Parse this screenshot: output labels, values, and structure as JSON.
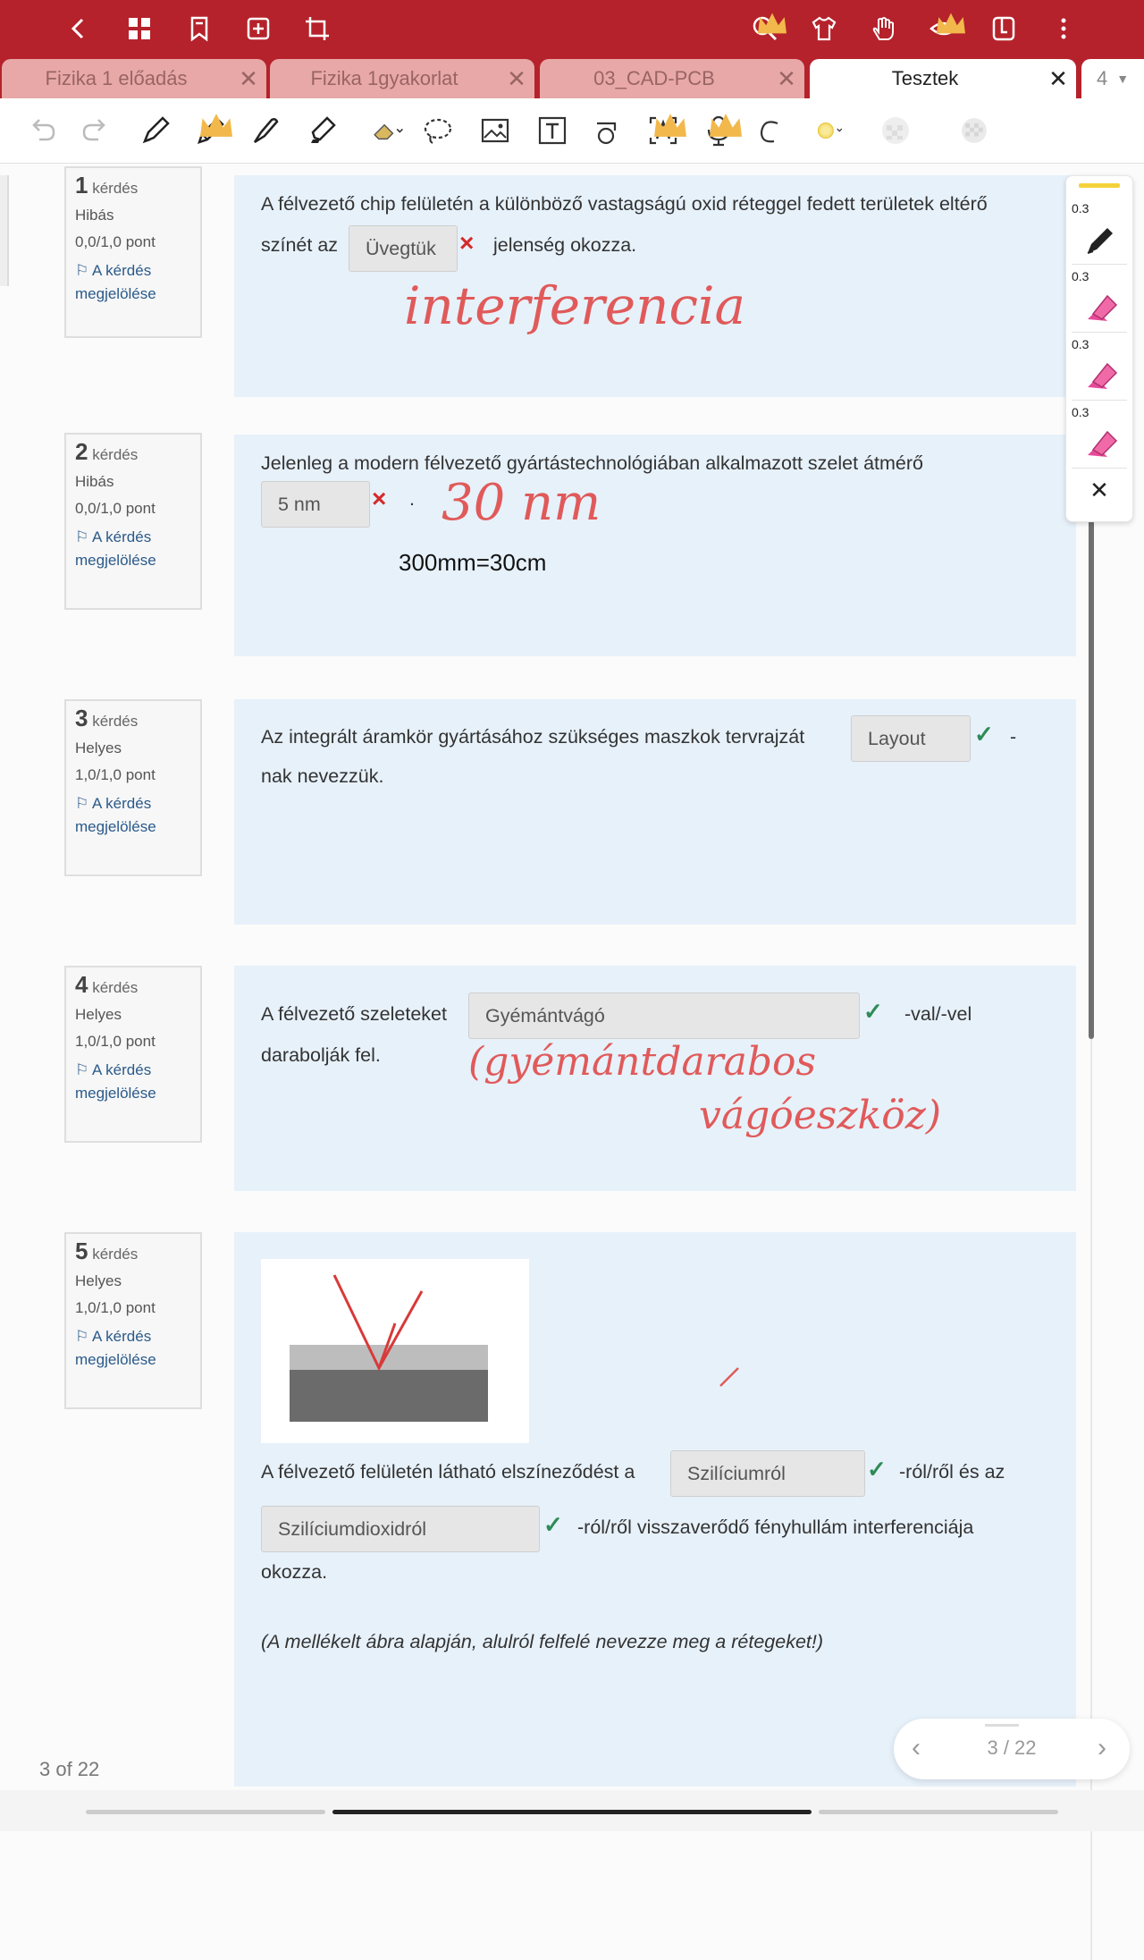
{
  "colors": {
    "brand": "#b5222b",
    "tab_inactive": "#e8a8a8",
    "question_bg": "#e7f1fa",
    "correct": "#2e8b57",
    "wrong": "#d42a2a",
    "handwriting": "#e05a5a"
  },
  "topbar": {
    "icons": [
      "back-icon",
      "grid-icon",
      "bookmark-icon",
      "add-page-icon",
      "crop-icon",
      "search-icon",
      "shirt-icon",
      "hand-gesture-icon",
      "eye-icon",
      "split-view-icon",
      "more-icon"
    ]
  },
  "tabs": [
    {
      "label": "Fizika 1 előadás",
      "active": false
    },
    {
      "label": "Fizika 1gyakorlat",
      "active": false
    },
    {
      "label": "03_CAD-PCB",
      "active": false
    },
    {
      "label": "Tesztek",
      "active": true
    }
  ],
  "tab_count": "4",
  "toolbar": {
    "tools": [
      "undo-icon",
      "redo-icon",
      "pen-icon",
      "pencil-icon",
      "fountain-pen-icon",
      "highlighter-icon",
      "eraser-icon",
      "lasso-icon",
      "image-icon",
      "text-box-icon",
      "shapes-icon",
      "text-recognition-icon",
      "microphone-icon",
      "shape-tool-icon",
      "color-picker-icon",
      "pattern-icon",
      "pattern-icon-2"
    ]
  },
  "palette": {
    "items": [
      {
        "size": "0.3",
        "tool": "pen"
      },
      {
        "size": "0.3",
        "tool": "highlighter"
      },
      {
        "size": "0.3",
        "tool": "highlighter"
      },
      {
        "size": "0.3",
        "tool": "highlighter"
      }
    ]
  },
  "questions": [
    {
      "num": "1",
      "word": "kérdés",
      "status": "Hibás",
      "points": "0,0/1,0 pont",
      "flag_1": "A kérdés",
      "flag_2": "megjelölése",
      "text_1": "A félvezető chip felületén a különböző vastagságú oxid réteggel fedett területek eltérő",
      "text_2a": "színét az",
      "answer": "Üvegtük",
      "text_2b": "jelenség okozza.",
      "handwriting": "interferencia"
    },
    {
      "num": "2",
      "word": "kérdés",
      "status": "Hibás",
      "points": "0,0/1,0 pont",
      "flag_1": "A kérdés",
      "flag_2": "megjelölése",
      "text_1": "Jelenleg a modern félvezető gyártástechnológiában alkalmazott szelet átmérő",
      "answer": "5 nm",
      "dot": ".",
      "handwriting": "30 nm",
      "typed_note": "300mm=30cm"
    },
    {
      "num": "3",
      "word": "kérdés",
      "status": "Helyes",
      "points": "1,0/1,0 pont",
      "flag_1": "A kérdés",
      "flag_2": "megjelölése",
      "text_1": "Az integrált áramkör gyártásához szükséges maszkok tervrajzát",
      "answer": "Layout",
      "suffix": "-",
      "text_2": "nak nevezzük."
    },
    {
      "num": "4",
      "word": "kérdés",
      "status": "Helyes",
      "points": "1,0/1,0 pont",
      "flag_1": "A kérdés",
      "flag_2": "megjelölése",
      "text_1": "A félvezető szeleteket",
      "answer": "Gyémántvágó",
      "suffix": "-val/-vel",
      "text_2": "darabolják fel.",
      "handwriting_1": "(gyémántdarabos",
      "handwriting_2": "vágóeszköz)"
    },
    {
      "num": "5",
      "word": "kérdés",
      "status": "Helyes",
      "points": "1,0/1,0 pont",
      "flag_1": "A kérdés",
      "flag_2": "megjelölése",
      "text_1": "A félvezető felületén látható elszíneződést a",
      "answer_1": "Szilíciumról",
      "suffix_1": "-ról/ről és az",
      "answer_2": "Szilíciumdioxidról",
      "suffix_2": "-ról/ről visszaverődő fényhullám interferenciája",
      "text_3": "okozza.",
      "hint": "(A mellékelt ábra alapján, alulról felfelé nevezze meg a rétegeket!)"
    }
  ],
  "footer": {
    "page_label": "3 of 22",
    "pager": "3 / 22"
  }
}
